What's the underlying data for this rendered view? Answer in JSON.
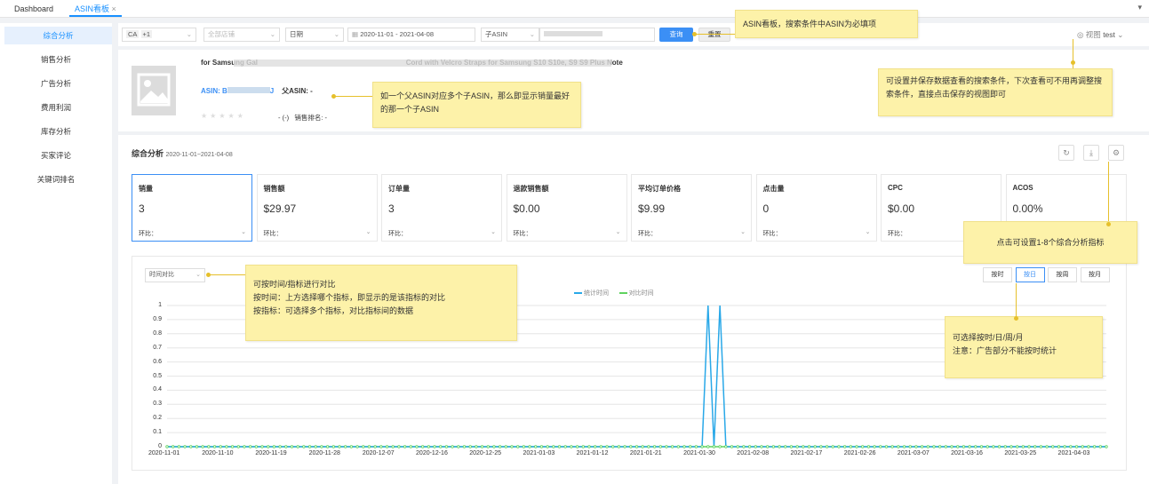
{
  "tabs": {
    "dashboard": "Dashboard",
    "asin": "ASIN看板",
    "close": "×",
    "more": "▾"
  },
  "sidebar": {
    "items": [
      "综合分析",
      "销售分析",
      "广告分析",
      "费用利润",
      "库存分析",
      "买家评论",
      "关键词排名"
    ]
  },
  "filters": {
    "region": "CA",
    "region_count": "+1",
    "store": "全部店铺",
    "date_type": "日期",
    "date_range": "2020-11-01  -  2021-04-08",
    "child_asin": "子ASIN",
    "search": "查询",
    "reset": "重置",
    "view": "视图",
    "user": "test"
  },
  "product": {
    "title": "for Samsung Gal                                                                           Cord with Velcro Straps for Samsung S10 S10e, S9 S9 Plus Note",
    "asin_label": "ASIN: B",
    "asin_tail": "J",
    "parent_label": "父ASIN: -",
    "rating": "- (-)",
    "rank": "销售排名: -"
  },
  "section": {
    "title": "综合分析",
    "range": "2020-11-01~2021-04-08"
  },
  "metrics": [
    {
      "label": "销量",
      "value": "3",
      "cmp": "环比："
    },
    {
      "label": "销售额",
      "value": "$29.97",
      "cmp": "环比："
    },
    {
      "label": "订单量",
      "value": "3",
      "cmp": "环比："
    },
    {
      "label": "退款销售额",
      "value": "$0.00",
      "cmp": "环比："
    },
    {
      "label": "平均订单价格",
      "value": "$9.99",
      "cmp": "环比："
    },
    {
      "label": "点击量",
      "value": "0",
      "cmp": "环比："
    },
    {
      "label": "CPC",
      "value": "$0.00",
      "cmp": "环比："
    },
    {
      "label": "ACOS",
      "value": "0.00%",
      "cmp": "环比："
    }
  ],
  "chart_controls": {
    "compare_mode": "时间对比",
    "granularity": [
      "按时",
      "按日",
      "按周",
      "按月"
    ],
    "active_granularity": "按日"
  },
  "notes": {
    "n1": "ASIN看板，搜索条件中ASIN为必填项",
    "n2": "可设置并保存数据查看的搜索条件，下次查看可不用再调整搜索条件，直接点击保存的视图即可",
    "n3": "如一个父ASIN对应多个子ASIN，那么即显示销量最好的那一个子ASIN",
    "n4": "点击可设置1-8个综合分析指标",
    "n5a": "可按时间/指标进行对比",
    "n5b": "按时间：上方选择哪个指标，即显示的是该指标的对比",
    "n5c": "按指标：可选择多个指标，对比指标间的数据",
    "n6a": "可选择按时/日/周/月",
    "n6b": "注意：广告部分不能按时统计"
  },
  "colors": {
    "accent": "#3b8ff5",
    "stat": "#29a8e8",
    "compare": "#5fd35f",
    "note": "#fdf2a9"
  },
  "chart_data": {
    "type": "line",
    "series": [
      {
        "name": "统计时间",
        "color": "#29a8e8",
        "spikes": [
          "2021-01-31",
          "2021-02-02"
        ]
      },
      {
        "name": "对比时间",
        "color": "#5fd35f"
      }
    ],
    "x_start": "2020-11-01",
    "x_end": "2021-04-08",
    "xticks": [
      "2020-11-01",
      "2020-11-10",
      "2020-11-19",
      "2020-11-28",
      "2020-12-07",
      "2020-12-16",
      "2020-12-25",
      "2021-01-03",
      "2021-01-12",
      "2021-01-21",
      "2021-01-30",
      "2021-02-08",
      "2021-02-17",
      "2021-02-26",
      "2021-03-07",
      "2021-03-16",
      "2021-03-25",
      "2021-04-03"
    ],
    "yticks": [
      "0",
      "0.1",
      "0.2",
      "0.3",
      "0.4",
      "0.5",
      "0.6",
      "0.7",
      "0.8",
      "0.9",
      "1"
    ],
    "ylim": [
      0,
      1
    ]
  }
}
